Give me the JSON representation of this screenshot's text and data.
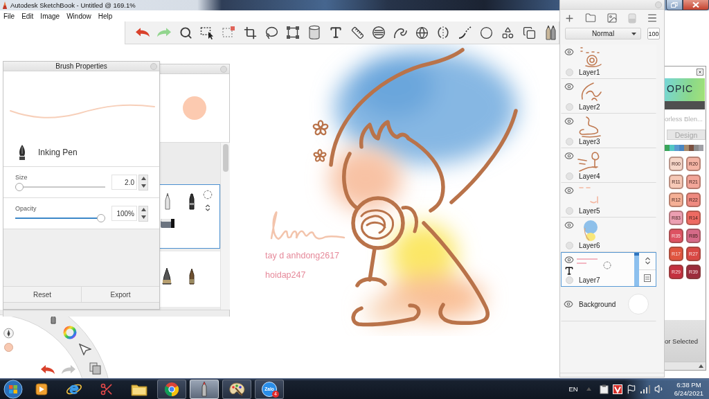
{
  "window": {
    "title": "Autodesk SketchBook - Untitled @ 169.1%"
  },
  "menu": [
    "File",
    "Edit",
    "Image",
    "Window",
    "Help"
  ],
  "brush_library": {
    "sets": [
      {
        "selected": true
      },
      {
        "selected": false
      }
    ]
  },
  "brush_properties": {
    "title": "Brush Properties",
    "brush_name": "Inking Pen",
    "size": {
      "label": "Size",
      "value": "2.0",
      "level": 0
    },
    "opacity": {
      "label": "Opacity",
      "value": "100%",
      "level": 1
    },
    "buttons": [
      "Reset",
      "Export"
    ]
  },
  "canvas": {
    "texts": [
      "tay d anhdong2617",
      "hoidap247"
    ]
  },
  "layers_panel": {
    "blend_mode": "Normal",
    "opacity": "100",
    "layers": [
      {
        "name": "Layer1",
        "kind": "paint",
        "visible": true,
        "selected": false
      },
      {
        "name": "Layer2",
        "kind": "paint",
        "visible": true,
        "selected": false
      },
      {
        "name": "Layer3",
        "kind": "paint",
        "visible": true,
        "selected": false
      },
      {
        "name": "Layer4",
        "kind": "paint",
        "visible": true,
        "selected": false
      },
      {
        "name": "Layer5",
        "kind": "paint",
        "visible": true,
        "selected": false
      },
      {
        "name": "Layer6",
        "kind": "paint",
        "visible": true,
        "selected": false
      },
      {
        "name": "Layer7",
        "kind": "text",
        "visible": true,
        "selected": true
      },
      {
        "name": "Background",
        "kind": "background",
        "visible": true,
        "selected": false
      }
    ]
  },
  "copic_panel": {
    "logo_text": "OPIC",
    "library": "orless Blen...",
    "tabs": [
      {
        "label": "Design",
        "selected": false
      }
    ],
    "swatches": [
      {
        "label": "R00",
        "color": "#f5d6c8"
      },
      {
        "label": "R20",
        "color": "#f4b4a4"
      },
      {
        "label": "R11",
        "color": "#f6c8b6"
      },
      {
        "label": "R21",
        "color": "#f2a598"
      },
      {
        "label": "R12",
        "color": "#f5b096"
      },
      {
        "label": "R22",
        "color": "#ef8a80"
      },
      {
        "label": "R83",
        "color": "#ec9fb2"
      },
      {
        "label": "R14",
        "color": "#ee6a62"
      },
      {
        "label": "R35",
        "color": "#dd5262"
      },
      {
        "label": "R85",
        "color": "#d56a88"
      },
      {
        "label": "R17",
        "color": "#e0553f"
      },
      {
        "label": "R27",
        "color": "#d84844"
      },
      {
        "label": "R29",
        "color": "#c4303e"
      },
      {
        "label": "R39",
        "color": "#9c2c3c"
      }
    ],
    "footer": "or Selected"
  },
  "taskbar": {
    "apps": [
      {
        "kind": "media-player",
        "running": false,
        "active": false
      },
      {
        "kind": "globe-e",
        "running": false,
        "active": false
      },
      {
        "kind": "scissors",
        "running": false,
        "active": false
      },
      {
        "kind": "folder",
        "running": false,
        "active": false
      },
      {
        "kind": "round-browser",
        "running": true,
        "active": false
      },
      {
        "kind": "pencil",
        "running": true,
        "active": true
      },
      {
        "kind": "palette",
        "running": true,
        "active": false
      },
      {
        "kind": "chat",
        "running": true,
        "active": false,
        "logo_text": "Zalo",
        "badge": "4"
      }
    ],
    "language": "EN",
    "time": "6:38 PM",
    "date": "6/24/2021"
  }
}
